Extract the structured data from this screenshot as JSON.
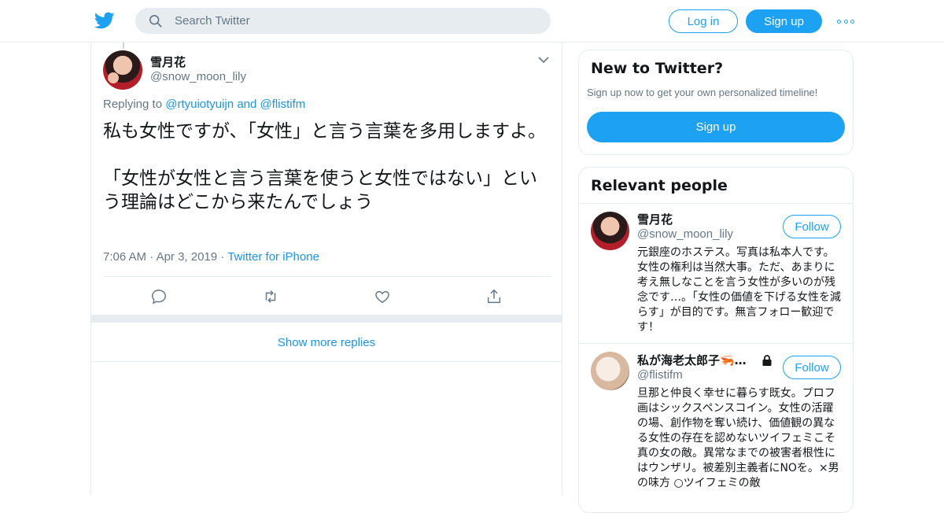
{
  "header": {
    "search_placeholder": "Search Twitter",
    "login_label": "Log in",
    "signup_label": "Sign up",
    "logo_icon": "twitter-bird-icon",
    "more_icon": "more-dots-icon"
  },
  "tweet": {
    "author_name": "雪月花",
    "author_handle": "@snow_moon_lily",
    "replying_prefix": "Replying to",
    "replying_to_1": "@rtyuiotyuijn",
    "replying_and": "and",
    "replying_to_2": "@flistifm",
    "text": "私も女性ですが、「女性」と言う言葉を多用しますよ。\n\n「女性が女性と言う言葉を使うと女性ではない」という理論はどこから来たんでしょう",
    "time": "7:06 AM",
    "sep": "·",
    "date": "Apr 3, 2019",
    "source": "Twitter for iPhone",
    "actions": [
      "reply-icon",
      "retweet-icon",
      "like-icon",
      "share-icon"
    ]
  },
  "show_more_replies": "Show more replies",
  "sidebar": {
    "new_title": "New to Twitter?",
    "new_desc": "Sign up now to get your own personalized timeline!",
    "new_signup": "Sign up",
    "relevant_title": "Relevant people",
    "people": [
      {
        "name": "雪月花",
        "handle": "@snow_moon_lily",
        "follow": "Follow",
        "bio": "元銀座のホステス。写真は私本人です。 女性の権利は当然大事。ただ、あまりに考え無しなことを言う女性が多いのが残念です…。「女性の価値を下げる女性を減らす」が目的です。無言フォロー歓迎です！"
      },
      {
        "name": "私が海老太郎子🦐…",
        "handle": "@flistifm",
        "follow": "Follow",
        "bio": "旦那と仲良く幸せに暮らす既女。プロフ画はシックスペンスコイン。女性の活躍の場、創作物を奪い続け、価値観の異なる女性の存在を認めないツイフェミこそ真の女の敵。異常なまでの被害者根性にはウンザリ。被差別主義者にNOを。×男の味方 ○ツイフェミの敵"
      }
    ]
  },
  "colors": {
    "accent": "#1da1f2",
    "link": "#1b95e0",
    "secondary_text": "#657786",
    "border": "#e6ecf0"
  }
}
